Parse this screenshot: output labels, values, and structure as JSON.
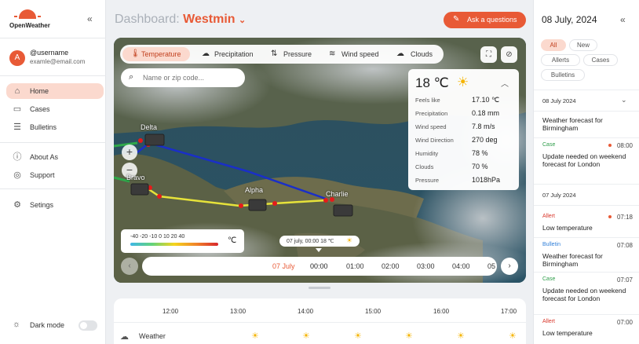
{
  "sidebar": {
    "logo_text": "OpenWeather",
    "collapse_icon": "double-chevron-left-icon",
    "user": {
      "avatar_letter": "A",
      "name": "@username",
      "email": "examle@email.com"
    },
    "nav": [
      {
        "label": "Home",
        "icon": "home-icon",
        "active": true
      },
      {
        "label": "Cases",
        "icon": "chat-icon"
      },
      {
        "label": "Bulletins",
        "icon": "document-icon"
      },
      {
        "label": "About As",
        "icon": "info-icon"
      },
      {
        "label": "Support",
        "icon": "lifebuoy-icon"
      },
      {
        "label": "Setings",
        "icon": "gear-icon"
      }
    ],
    "dark_mode_label": "Dark mode",
    "dark_mode_on": false
  },
  "header": {
    "title_prefix": "Dashboard:",
    "location": "Westmin",
    "ask_button": "Ask a questions"
  },
  "map": {
    "layers": [
      {
        "label": "Temperature",
        "icon": "thermometer-icon",
        "active": true
      },
      {
        "label": "Precipitation",
        "icon": "rain-cloud-icon"
      },
      {
        "label": "Pressure",
        "icon": "pressure-arrows-icon"
      },
      {
        "label": "Wind speed",
        "icon": "wind-icon"
      },
      {
        "label": "Clouds",
        "icon": "cloud-icon"
      }
    ],
    "search_placeholder": "Name or zip code...",
    "nodes": [
      "Delta",
      "Bravo",
      "Alpha",
      "Charlie"
    ],
    "weather_card": {
      "temp": "18 ℃",
      "rows": [
        {
          "k": "Feels like",
          "v": "17.10 ℃"
        },
        {
          "k": "Precipitation",
          "v": "0.18 mm"
        },
        {
          "k": "Wind speed",
          "v": "7.8 m/s"
        },
        {
          "k": "Wind Direction",
          "v": "270 deg"
        },
        {
          "k": "Humidity",
          "v": "78 %"
        },
        {
          "k": "Clouds",
          "v": "70 %"
        },
        {
          "k": "Pressure",
          "v": "1018hPa"
        }
      ]
    },
    "legend": {
      "values": "-40  -20  -10   0   10   20   40",
      "unit": "℃"
    },
    "timeline_tooltip": "07 july, 00:00  18 ℃",
    "timeline": [
      {
        "label": "07 July",
        "kind": "date"
      },
      {
        "label": "00:00",
        "kind": "current"
      },
      {
        "label": "01:00"
      },
      {
        "label": "02:00"
      },
      {
        "label": "03:00"
      },
      {
        "label": "04:00"
      },
      {
        "label": "05"
      }
    ]
  },
  "forecast": {
    "hours": [
      "12:00",
      "13:00",
      "14:00",
      "15:00",
      "16:00",
      "17:00"
    ],
    "row_label": "Weather",
    "row_icon": "cloud-icon"
  },
  "right_panel": {
    "date": "08 July, 2024",
    "filters": [
      {
        "label": "All",
        "active": true
      },
      {
        "label": "New"
      },
      {
        "label": "Allerts"
      },
      {
        "label": "Cases"
      },
      {
        "label": "Bulletins"
      }
    ],
    "groups": [
      {
        "head": "08 July 2024",
        "items": [
          {
            "tag": "",
            "time": "",
            "text": "Weather forecast for Birmingham"
          },
          {
            "tag": "Case",
            "time": "08:00",
            "dot": true,
            "text": "Update needed on weekend forecast for London"
          }
        ]
      },
      {
        "head": "07 July 2024",
        "items": [
          {
            "tag": "Allert",
            "time": "07:18",
            "dot": true,
            "text": "Low temperature"
          },
          {
            "tag": "Bulletin",
            "time": "07:08",
            "text": "Weather forecast for Birmingham"
          },
          {
            "tag": "Case",
            "time": "07:07",
            "text": "Update needed on weekend forecast for London"
          },
          {
            "tag": "Allert",
            "time": "07:00",
            "text": "Low temperature"
          }
        ]
      }
    ],
    "tag_colors": {
      "Case": "#2e9d4a",
      "Allert": "#d9372b",
      "Bulletin": "#2f7fd9"
    }
  }
}
